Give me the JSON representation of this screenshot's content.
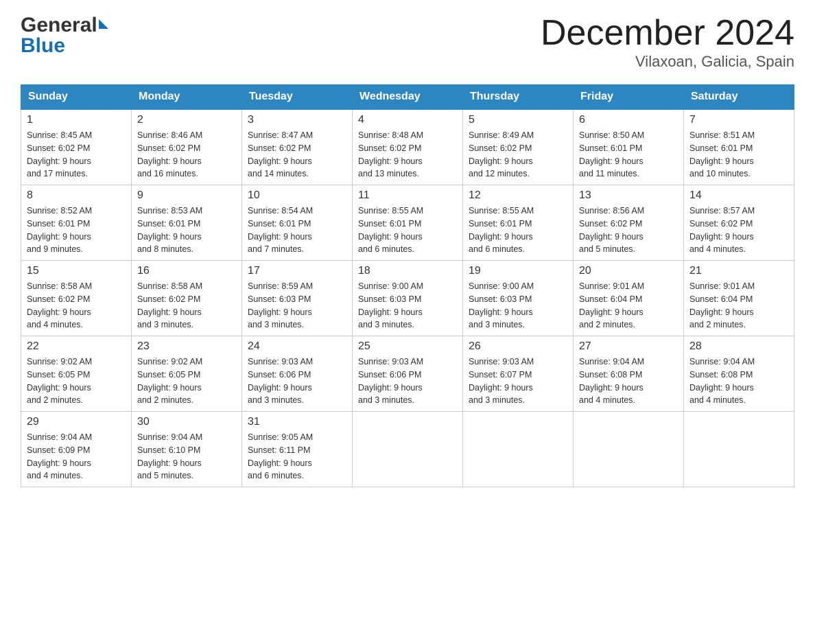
{
  "logo": {
    "line1": "General",
    "line2": "Blue"
  },
  "title": "December 2024",
  "subtitle": "Vilaxoan, Galicia, Spain",
  "days_of_week": [
    "Sunday",
    "Monday",
    "Tuesday",
    "Wednesday",
    "Thursday",
    "Friday",
    "Saturday"
  ],
  "weeks": [
    [
      {
        "day": "1",
        "sunrise": "8:45 AM",
        "sunset": "6:02 PM",
        "daylight": "9 hours and 17 minutes."
      },
      {
        "day": "2",
        "sunrise": "8:46 AM",
        "sunset": "6:02 PM",
        "daylight": "9 hours and 16 minutes."
      },
      {
        "day": "3",
        "sunrise": "8:47 AM",
        "sunset": "6:02 PM",
        "daylight": "9 hours and 14 minutes."
      },
      {
        "day": "4",
        "sunrise": "8:48 AM",
        "sunset": "6:02 PM",
        "daylight": "9 hours and 13 minutes."
      },
      {
        "day": "5",
        "sunrise": "8:49 AM",
        "sunset": "6:02 PM",
        "daylight": "9 hours and 12 minutes."
      },
      {
        "day": "6",
        "sunrise": "8:50 AM",
        "sunset": "6:01 PM",
        "daylight": "9 hours and 11 minutes."
      },
      {
        "day": "7",
        "sunrise": "8:51 AM",
        "sunset": "6:01 PM",
        "daylight": "9 hours and 10 minutes."
      }
    ],
    [
      {
        "day": "8",
        "sunrise": "8:52 AM",
        "sunset": "6:01 PM",
        "daylight": "9 hours and 9 minutes."
      },
      {
        "day": "9",
        "sunrise": "8:53 AM",
        "sunset": "6:01 PM",
        "daylight": "9 hours and 8 minutes."
      },
      {
        "day": "10",
        "sunrise": "8:54 AM",
        "sunset": "6:01 PM",
        "daylight": "9 hours and 7 minutes."
      },
      {
        "day": "11",
        "sunrise": "8:55 AM",
        "sunset": "6:01 PM",
        "daylight": "9 hours and 6 minutes."
      },
      {
        "day": "12",
        "sunrise": "8:55 AM",
        "sunset": "6:01 PM",
        "daylight": "9 hours and 6 minutes."
      },
      {
        "day": "13",
        "sunrise": "8:56 AM",
        "sunset": "6:02 PM",
        "daylight": "9 hours and 5 minutes."
      },
      {
        "day": "14",
        "sunrise": "8:57 AM",
        "sunset": "6:02 PM",
        "daylight": "9 hours and 4 minutes."
      }
    ],
    [
      {
        "day": "15",
        "sunrise": "8:58 AM",
        "sunset": "6:02 PM",
        "daylight": "9 hours and 4 minutes."
      },
      {
        "day": "16",
        "sunrise": "8:58 AM",
        "sunset": "6:02 PM",
        "daylight": "9 hours and 3 minutes."
      },
      {
        "day": "17",
        "sunrise": "8:59 AM",
        "sunset": "6:03 PM",
        "daylight": "9 hours and 3 minutes."
      },
      {
        "day": "18",
        "sunrise": "9:00 AM",
        "sunset": "6:03 PM",
        "daylight": "9 hours and 3 minutes."
      },
      {
        "day": "19",
        "sunrise": "9:00 AM",
        "sunset": "6:03 PM",
        "daylight": "9 hours and 3 minutes."
      },
      {
        "day": "20",
        "sunrise": "9:01 AM",
        "sunset": "6:04 PM",
        "daylight": "9 hours and 2 minutes."
      },
      {
        "day": "21",
        "sunrise": "9:01 AM",
        "sunset": "6:04 PM",
        "daylight": "9 hours and 2 minutes."
      }
    ],
    [
      {
        "day": "22",
        "sunrise": "9:02 AM",
        "sunset": "6:05 PM",
        "daylight": "9 hours and 2 minutes."
      },
      {
        "day": "23",
        "sunrise": "9:02 AM",
        "sunset": "6:05 PM",
        "daylight": "9 hours and 2 minutes."
      },
      {
        "day": "24",
        "sunrise": "9:03 AM",
        "sunset": "6:06 PM",
        "daylight": "9 hours and 3 minutes."
      },
      {
        "day": "25",
        "sunrise": "9:03 AM",
        "sunset": "6:06 PM",
        "daylight": "9 hours and 3 minutes."
      },
      {
        "day": "26",
        "sunrise": "9:03 AM",
        "sunset": "6:07 PM",
        "daylight": "9 hours and 3 minutes."
      },
      {
        "day": "27",
        "sunrise": "9:04 AM",
        "sunset": "6:08 PM",
        "daylight": "9 hours and 4 minutes."
      },
      {
        "day": "28",
        "sunrise": "9:04 AM",
        "sunset": "6:08 PM",
        "daylight": "9 hours and 4 minutes."
      }
    ],
    [
      {
        "day": "29",
        "sunrise": "9:04 AM",
        "sunset": "6:09 PM",
        "daylight": "9 hours and 4 minutes."
      },
      {
        "day": "30",
        "sunrise": "9:04 AM",
        "sunset": "6:10 PM",
        "daylight": "9 hours and 5 minutes."
      },
      {
        "day": "31",
        "sunrise": "9:05 AM",
        "sunset": "6:11 PM",
        "daylight": "9 hours and 6 minutes."
      },
      null,
      null,
      null,
      null
    ]
  ],
  "labels": {
    "sunrise": "Sunrise:",
    "sunset": "Sunset:",
    "daylight": "Daylight:"
  }
}
